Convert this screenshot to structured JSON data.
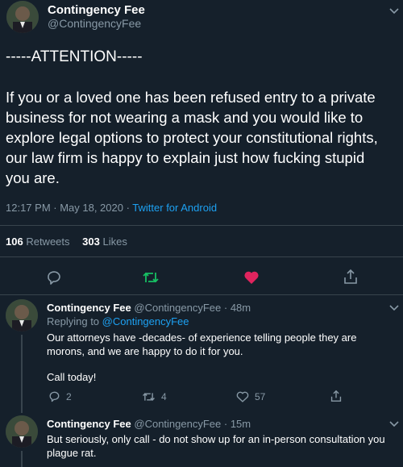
{
  "main_tweet": {
    "display_name": "Contingency Fee",
    "handle": "@ContingencyFee",
    "heading": "-----ATTENTION-----",
    "body_lines": [
      "If you or a loved one has been refused entry to a private",
      "business for not wearing a mask and you would like to",
      "explore legal options to protect your constitutional rights,",
      "our law firm is happy to explain just how fucking stupid",
      "you are."
    ],
    "timestamp": "12:17 PM · May 18, 2020 · ",
    "client": "Twitter for Android",
    "retweets_count": "106",
    "retweets_label": "Retweets",
    "likes_count": "303",
    "likes_label": "Likes"
  },
  "replies": [
    {
      "display_name": "Contingency Fee",
      "handle": "@ContingencyFee",
      "time": "· 48m",
      "replying_prefix": "Replying to ",
      "replying_to": "@ContingencyFee",
      "body_lines": [
        "Our attorneys have -decades- of experience telling people they are",
        "morons, and we are happy to do it for you."
      ],
      "body_extra": "Call today!",
      "reply_count": "2",
      "retweet_count": "4",
      "like_count": "57"
    },
    {
      "display_name": "Contingency Fee",
      "handle": "@ContingencyFee",
      "time": "· 15m",
      "body_lines": [
        "But seriously, only call - do not show up for an in-person consultation you",
        "plague rat."
      ]
    }
  ],
  "colors": {
    "background": "#15202b",
    "muted": "#8899a6",
    "link": "#1da1f2",
    "like": "#e0245e",
    "retweet": "#17bf63"
  },
  "icons": [
    "reply-icon",
    "retweet-icon",
    "like-icon",
    "share-icon",
    "chevron-down-icon"
  ]
}
